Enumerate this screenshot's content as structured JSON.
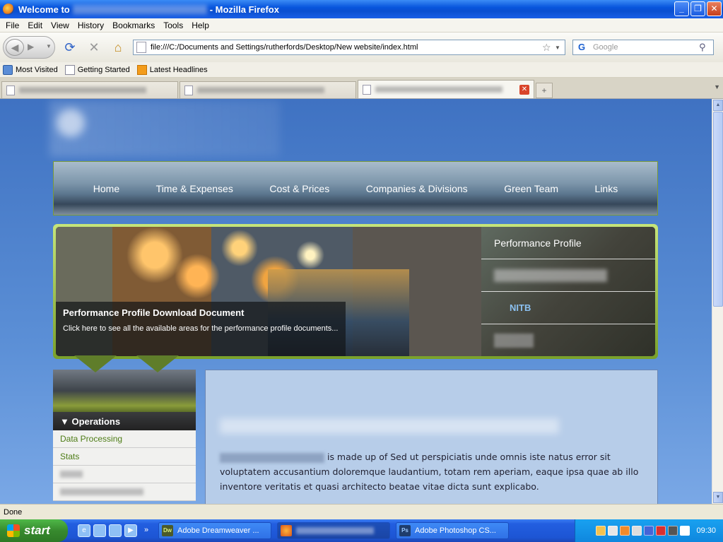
{
  "window": {
    "title_prefix": "Welcome to",
    "title_suffix": "- Mozilla Firefox",
    "buttons": {
      "minimize": "_",
      "restore": "❐",
      "close": "✕"
    }
  },
  "menu": [
    "File",
    "Edit",
    "View",
    "History",
    "Bookmarks",
    "Tools",
    "Help"
  ],
  "navbar": {
    "url": "file:///C:/Documents and Settings/rutherfords/Desktop/New website/index.html",
    "search_placeholder": "Google",
    "search_engine": "G"
  },
  "bookmarks": [
    "Most Visited",
    "Getting Started",
    "Latest Headlines"
  ],
  "tabs": {
    "close": "✕",
    "new_tab": "+"
  },
  "page": {
    "nav": [
      "Home",
      "Time & Expenses",
      "Cost & Prices",
      "Companies & Divisions",
      "Green Team",
      "Links"
    ],
    "banner": {
      "caption_title": "Performance Profile Download Document",
      "caption_text": "Click here to see all the available areas for the performance profile documents...",
      "side_items": [
        "Performance Profile",
        "",
        "NITB",
        ""
      ]
    },
    "sidebar": {
      "heading": "▼ Operations",
      "items": [
        "Data Processing",
        "Stats"
      ]
    },
    "content": {
      "paragraph": " is made up of Sed ut perspiciatis unde omnis iste natus error sit voluptatem accusantium doloremque laudantium, totam rem aperiam, eaque ipsa quae ab illo inventore veritatis et quasi architecto beatae vitae dicta sunt explicabo."
    }
  },
  "status": "Done",
  "taskbar": {
    "start": "start",
    "buttons": [
      "Adobe Dreamweaver ...",
      "",
      "Adobe Photoshop CS..."
    ],
    "clock": "09:30"
  }
}
